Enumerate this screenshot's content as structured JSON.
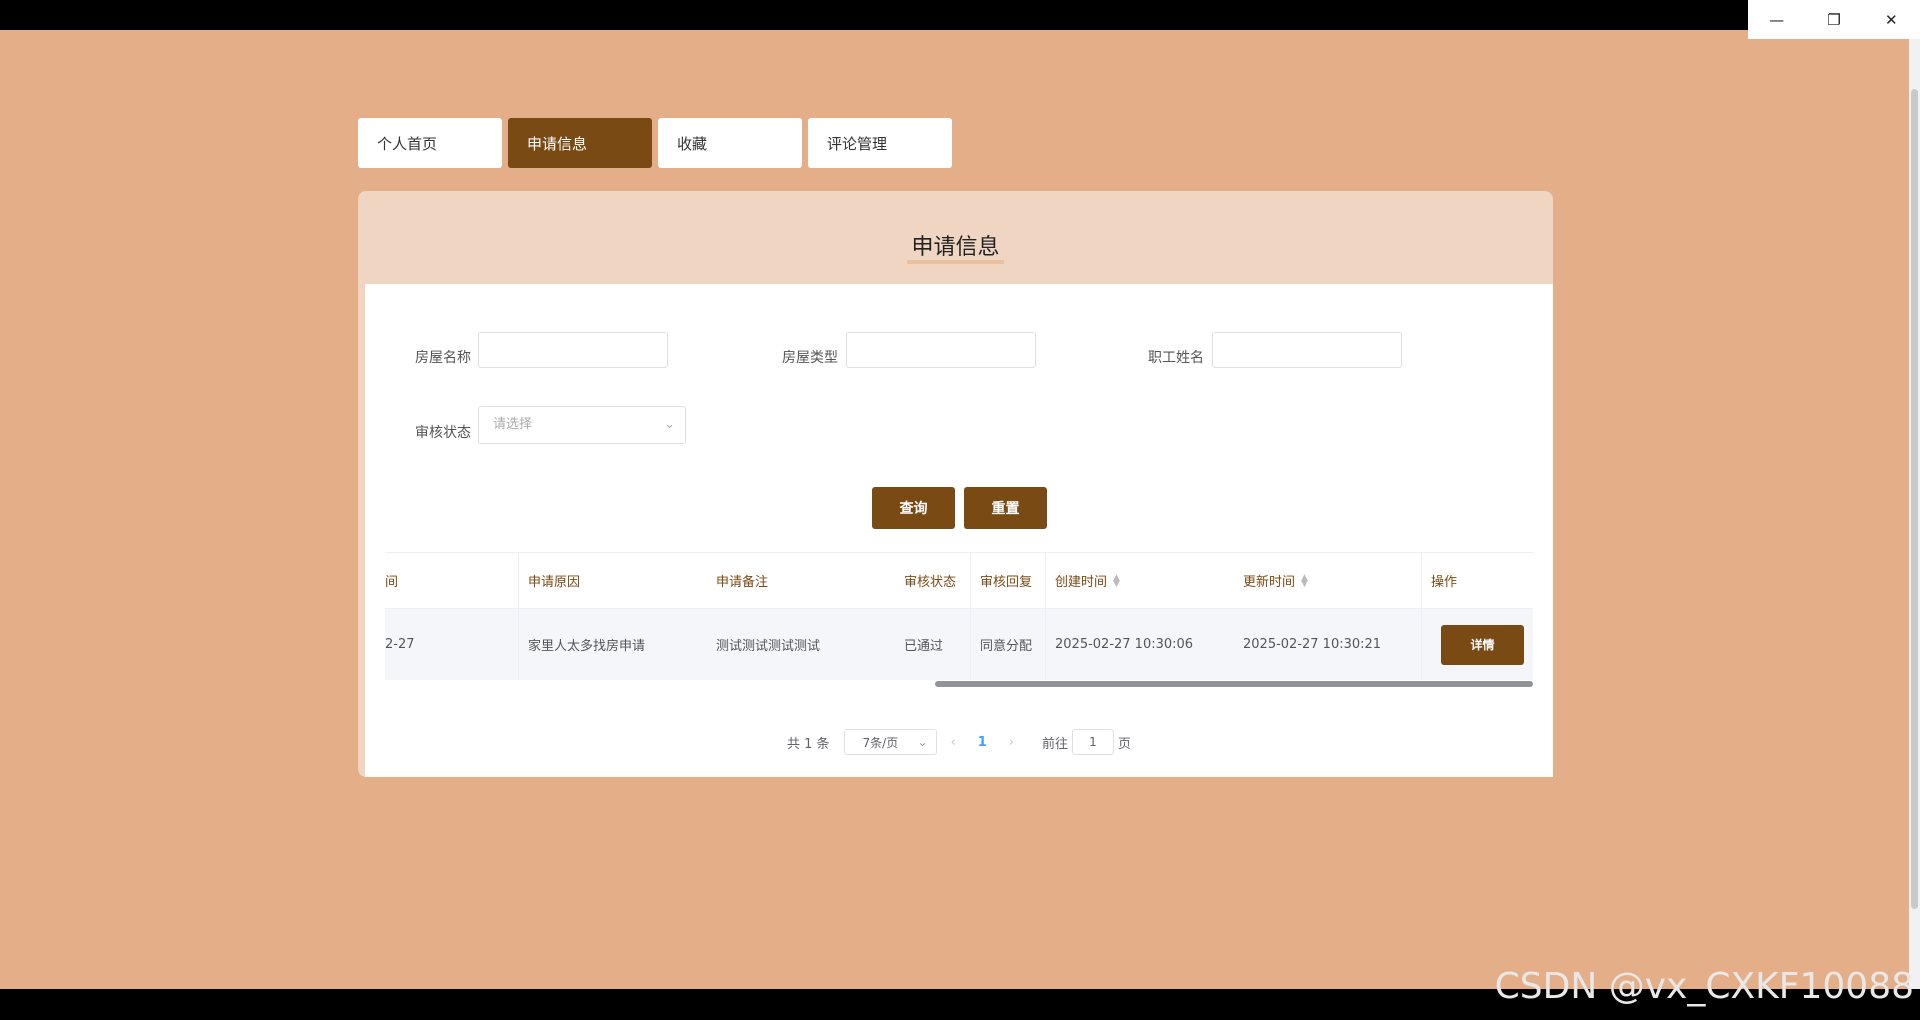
{
  "window": {
    "minimize": "—",
    "restore": "❐",
    "close": "✕"
  },
  "tabs": [
    {
      "label": "个人首页"
    },
    {
      "label": "申请信息"
    },
    {
      "label": "收藏"
    },
    {
      "label": "评论管理"
    }
  ],
  "panel": {
    "title": "申请信息"
  },
  "filters": {
    "house_name_label": "房屋名称",
    "house_type_label": "房屋类型",
    "employee_name_label": "职工姓名",
    "audit_status_label": "审核状态",
    "audit_status_placeholder": "请选择"
  },
  "buttons": {
    "query": "查询",
    "reset": "重置"
  },
  "table": {
    "headers": {
      "date": "间",
      "reason": "申请原因",
      "remark": "申请备注",
      "status": "审核状态",
      "reply": "审核回复",
      "created": "创建时间",
      "updated": "更新时间",
      "action": "操作"
    },
    "rows": [
      {
        "date": "2-27",
        "reason": "家里人太多找房申请",
        "remark": "测试测试测试测试",
        "status": "已通过",
        "reply": "同意分配",
        "created": "2025-02-27 10:30:06",
        "updated": "2025-02-27 10:30:21",
        "action": "详情"
      }
    ]
  },
  "pagination": {
    "total": "共 1 条",
    "page_size": "7条/页",
    "current": "1",
    "goto_label": "前往",
    "goto_value": "1",
    "goto_unit": "页"
  },
  "watermark": "CSDN @vx_CXKF10088",
  "colors": {
    "background": "#e3ae88",
    "accent": "#7a4a15",
    "panel_header": "#f0d6c2"
  }
}
